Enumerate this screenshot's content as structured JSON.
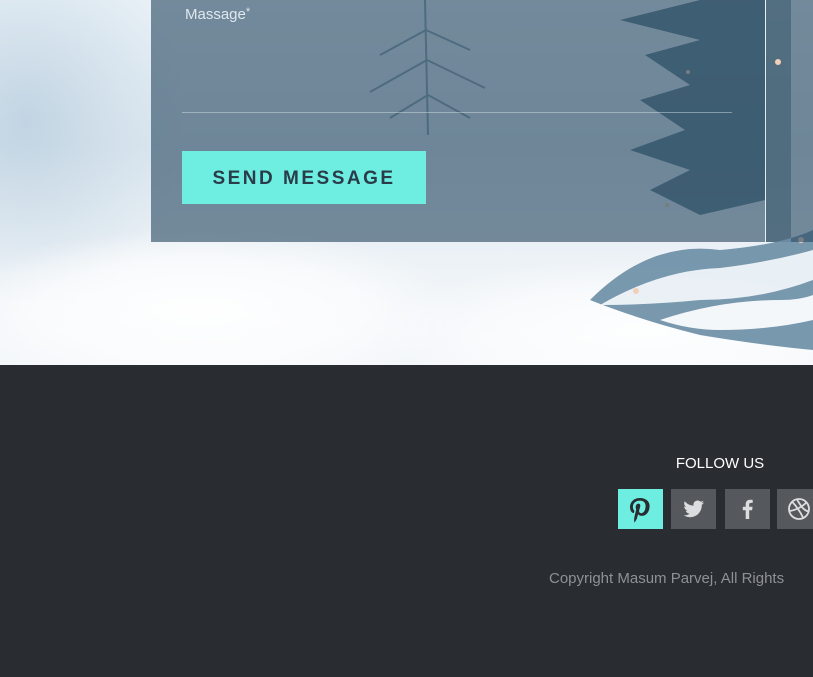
{
  "contact_form": {
    "message_label": "Massage",
    "required_mark": "*",
    "message_value": "",
    "send_label": "SEND MESSAGE"
  },
  "footer": {
    "follow_title": "FOLLOW US",
    "social_links": [
      {
        "name": "pinterest",
        "icon": "pinterest-icon",
        "active": true
      },
      {
        "name": "twitter",
        "icon": "twitter-icon",
        "active": false
      },
      {
        "name": "facebook",
        "icon": "facebook-icon",
        "active": false
      },
      {
        "name": "dribbble",
        "icon": "dribbble-icon",
        "active": false
      }
    ],
    "copyright": "Copyright Masum Parvej, All Rights"
  },
  "colors": {
    "accent": "#6eede1",
    "footer_bg": "#292c31",
    "social_bg": "#55585c",
    "panel_overlay": "#2a4a62"
  }
}
